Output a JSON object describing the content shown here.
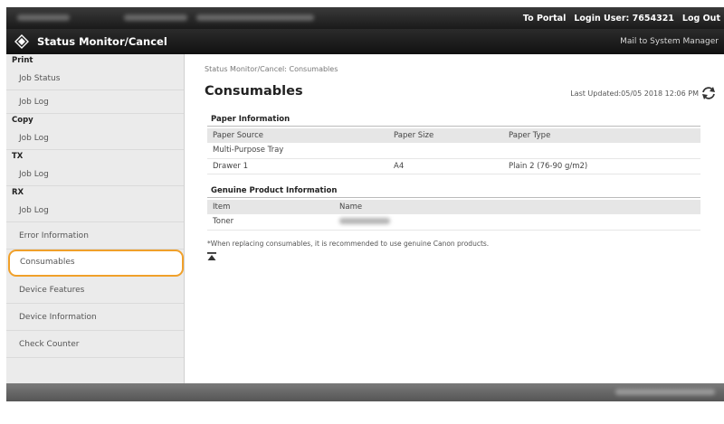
{
  "topbar": {
    "portal_link": "To Portal",
    "login_user": "Login User: 7654321",
    "logout": "Log Out"
  },
  "header": {
    "title": "Status Monitor/Cancel",
    "mail_link": "Mail to System Manager"
  },
  "sidebar": {
    "groups": [
      {
        "heading": "Print",
        "items": [
          "Job Status",
          "Job Log"
        ]
      },
      {
        "heading": "Copy",
        "items": [
          "Job Log"
        ]
      },
      {
        "heading": "TX",
        "items": [
          "Job Log"
        ]
      },
      {
        "heading": "RX",
        "items": [
          "Job Log"
        ]
      }
    ],
    "items": [
      "Error Information",
      "Consumables",
      "Device Features",
      "Device Information",
      "Check Counter"
    ],
    "active": "Consumables"
  },
  "main": {
    "breadcrumb": "Status Monitor/Cancel: Consumables",
    "title": "Consumables",
    "last_updated": "Last Updated:05/05 2018 12:06 PM",
    "paper_section": {
      "title": "Paper Information",
      "headers": [
        "Paper Source",
        "Paper Size",
        "Paper Type"
      ],
      "rows": [
        [
          "Multi-Purpose Tray",
          "",
          ""
        ],
        [
          "Drawer 1",
          "A4",
          "Plain 2 (76-90 g/m2)"
        ]
      ]
    },
    "genuine_section": {
      "title": "Genuine Product Information",
      "headers": [
        "Item",
        "Name"
      ],
      "rows": [
        [
          "Toner",
          ""
        ]
      ]
    },
    "note": "*When replacing consumables, it is recommended to use genuine Canon products."
  },
  "colors": {
    "accent": "#f0a02a",
    "header_bg": "#1a1a1a"
  },
  "icons": {
    "logo": "status-monitor-logo-icon",
    "refresh": "refresh-icon",
    "to_top": "to-top-icon"
  }
}
